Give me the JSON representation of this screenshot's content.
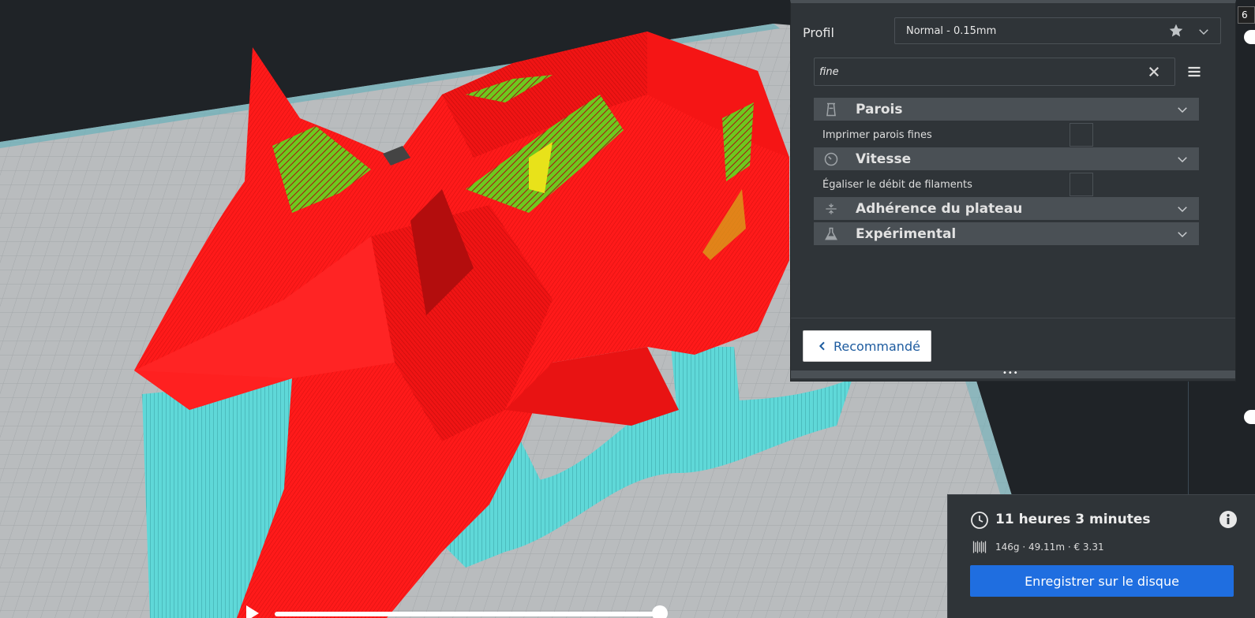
{
  "settings": {
    "profile_label": "Profil",
    "profile_value": "Normal - 0.15mm",
    "search_value": "fine",
    "categories": [
      {
        "label": "Parois",
        "icon": "walls-icon"
      },
      {
        "label": "Vitesse",
        "icon": "speed-gauge-icon"
      },
      {
        "label": "Adhérence du plateau",
        "icon": "bed-adhesion-icon"
      },
      {
        "label": "Expérimental",
        "icon": "flask-icon"
      }
    ],
    "settings_rows": [
      {
        "label": "Imprimer parois fines",
        "checked": false
      },
      {
        "label": "Égaliser le débit de filaments",
        "checked": false
      }
    ],
    "recommended_label": "Recommandé"
  },
  "output": {
    "print_time": "11 heures 3 minutes",
    "material": "146g · 49.11m · € 3.31",
    "save_label": "Enregistrer sur le disque"
  },
  "layer_slider": {
    "current_layer": "6"
  },
  "colors": {
    "panel_bg": "#2f3438",
    "category_bg": "#4a5055",
    "accent_blue": "#1f6ee0",
    "model_shell": "#ff1a1a",
    "support": "#5fd8d8",
    "infill": "#e8e21a"
  }
}
